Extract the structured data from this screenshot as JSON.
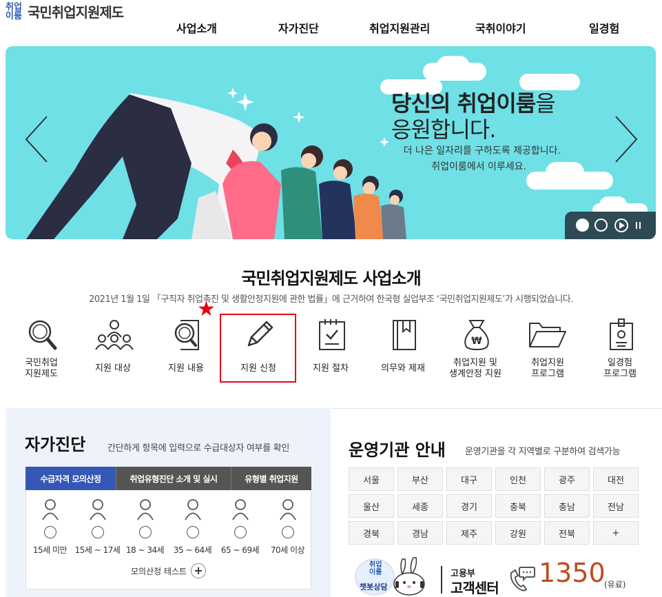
{
  "logo": {
    "mark_top": "취업",
    "mark_bottom": "이룸",
    "text": "국민취업지원제도"
  },
  "gnb": [
    "사업소개",
    "자가진단",
    "취업지원관리",
    "국취이야기",
    "일경험"
  ],
  "banner": {
    "title_bold": "당신의 취업이룸",
    "title_tail": "을",
    "title_line2": "응원합니다.",
    "desc_line1": "더 나은 일자리를 구하도록 제공합니다.",
    "desc_line2": "취업이룸에서 이루세요."
  },
  "intro": {
    "title": "국민취업지원제도 사업소개",
    "subtitle": "2021년 1월 1일 「구직자 취업촉진 및 생활안정지원에 관한 법률」에 근거하여 한국형 실업부조 ‘국민취업지원제도’가 시행되었습니다."
  },
  "menu": [
    {
      "line1": "국민취업",
      "line2": "지원제도",
      "icon": "magnifier-icon"
    },
    {
      "line1": "지원 대상",
      "line2": "",
      "icon": "people-group-icon"
    },
    {
      "line1": "지원 내용",
      "line2": "",
      "icon": "document-search-icon"
    },
    {
      "line1": "지원 신청",
      "line2": "",
      "icon": "pencil-icon"
    },
    {
      "line1": "지원 절차",
      "line2": "",
      "icon": "checklist-icon"
    },
    {
      "line1": "의무와 제재",
      "line2": "",
      "icon": "book-icon"
    },
    {
      "line1": "취업지원 및",
      "line2": "생계안정 지원",
      "icon": "money-bag-icon"
    },
    {
      "line1": "취업지원",
      "line2": "프로그램",
      "icon": "folder-icon"
    },
    {
      "line1": "일경험",
      "line2": "프로그램",
      "icon": "id-badge-icon"
    }
  ],
  "self_check": {
    "title": "자가진단",
    "desc": "간단하게 항목에 입력으로 수급대상자 여부를 확인",
    "tabs": [
      "수급자격 모의산정",
      "취업유형진단 소개 및 실시",
      "유형별 취업지원"
    ],
    "active_tab": 0,
    "ages": [
      "15세 미만",
      "15세 ~ 17세",
      "18 ~ 34세",
      "35 ~ 64세",
      "65 ~ 69세",
      "70세 이상"
    ],
    "test_label": "모의산정 테스트",
    "test_plus": "+"
  },
  "agency": {
    "title": "운영기관 안내",
    "desc": "운영기관을 각 지역별로 구분하여 검색가능",
    "regions": [
      "서울",
      "부산",
      "대구",
      "인천",
      "광주",
      "대전",
      "울산",
      "세종",
      "경기",
      "충북",
      "충남",
      "전남",
      "경북",
      "경남",
      "제주",
      "강원",
      "전북",
      "+"
    ]
  },
  "contact": {
    "chatbot_top": "취업",
    "chatbot_mid": "이룸",
    "chatbot_label": "챗봇상담",
    "label1": "고용부",
    "label2": "고객센터",
    "number": "1350",
    "paid": "(유료)"
  },
  "colors": {
    "accent": "#3558b6",
    "banner_bg": "#6fe0e6",
    "highlight": "#e60012",
    "number": "#c24a1e"
  }
}
